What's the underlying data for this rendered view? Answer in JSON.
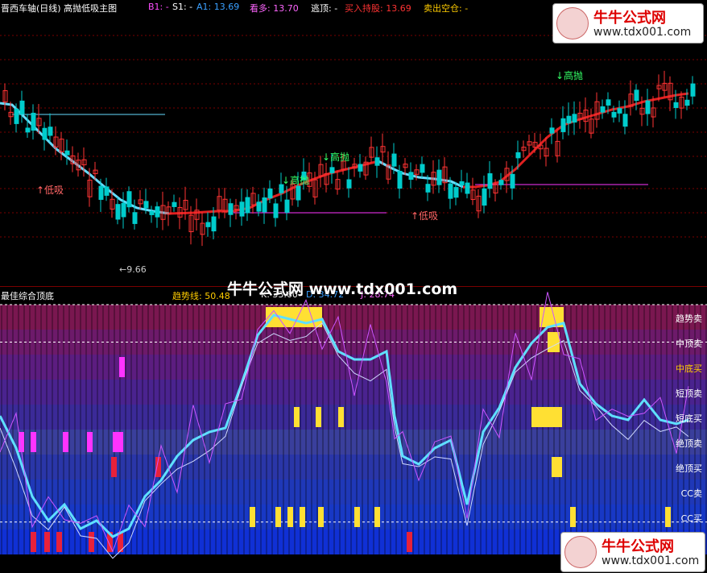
{
  "top": {
    "title": "晋西车轴(日线) 高抛低吸主图",
    "legend": [
      {
        "label": "B1: -",
        "color": "#ff4dff"
      },
      {
        "label": "S1: -",
        "color": "#ffffff"
      },
      {
        "label": "A1: 13.69",
        "color": "#3aa0ff"
      },
      {
        "label": "看多: 13.70",
        "color": "#ff66ff"
      },
      {
        "label": "逃顶: -",
        "color": "#ffffff"
      },
      {
        "label": "买入持股: 13.69",
        "color": "#ff3333"
      },
      {
        "label": "卖出空仓: -",
        "color": "#ffcc00"
      }
    ],
    "low_price_label": "←9.66",
    "signals": {
      "high_sell": "高抛",
      "low_buy": "低吸"
    }
  },
  "bottom": {
    "title": "最佳综合顶底",
    "indicators": [
      {
        "label": "趋势线: 50.48",
        "color": "#ffcc00"
      },
      {
        "label": "K: 33.60",
        "color": "#ffffff"
      },
      {
        "label": "D: 34.72",
        "color": "#3aa0ff"
      },
      {
        "label": "J: 28.74",
        "color": "#ff66ff"
      }
    ],
    "band_labels": [
      "趋势卖",
      "中顶卖",
      "中底买",
      "短顶卖",
      "短底买",
      "绝顶卖",
      "绝顶买",
      "CC卖",
      "CC买"
    ],
    "band_label_colors": [
      "#ffffff",
      "#ffffff",
      "#ffcc00",
      "#ffffff",
      "#ffffff",
      "#ffffff",
      "#ffffff",
      "#ffffff",
      "#ffffff"
    ]
  },
  "watermark": {
    "site_name": "牛牛公式网",
    "url": "www.tdx001.com",
    "center_text": "牛牛公式网  www.tdx001.com"
  },
  "colors": {
    "up_candle": "#ff3333",
    "down_candle": "#00cccc",
    "ma_up": "#e02020",
    "ma_down": "#66ddff",
    "grid": "#7a0000"
  }
}
